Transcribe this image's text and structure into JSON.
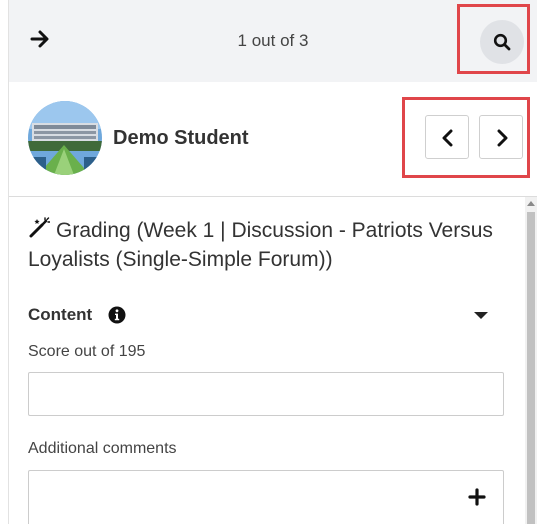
{
  "header": {
    "counter": "1 out of 3"
  },
  "student": {
    "name": "Demo Student"
  },
  "grading": {
    "title": "Grading (Week 1 | Discussion - Patriots Versus Loyalists (Single-Simple Forum))",
    "section_label": "Content",
    "score_label": "Score out of 195",
    "score_value": "",
    "comments_label": "Additional comments"
  },
  "icons": {
    "back": "arrow-right-icon",
    "search": "search-icon",
    "prev": "chevron-left-icon",
    "next": "chevron-right-icon",
    "wand": "magic-wand-icon",
    "info": "info-circle-icon",
    "collapse": "caret-down-icon",
    "add": "plus-icon"
  },
  "colors": {
    "highlight": "#e0464a",
    "topbar_bg": "#f2f3f5",
    "search_bg": "#e0e2e6"
  }
}
